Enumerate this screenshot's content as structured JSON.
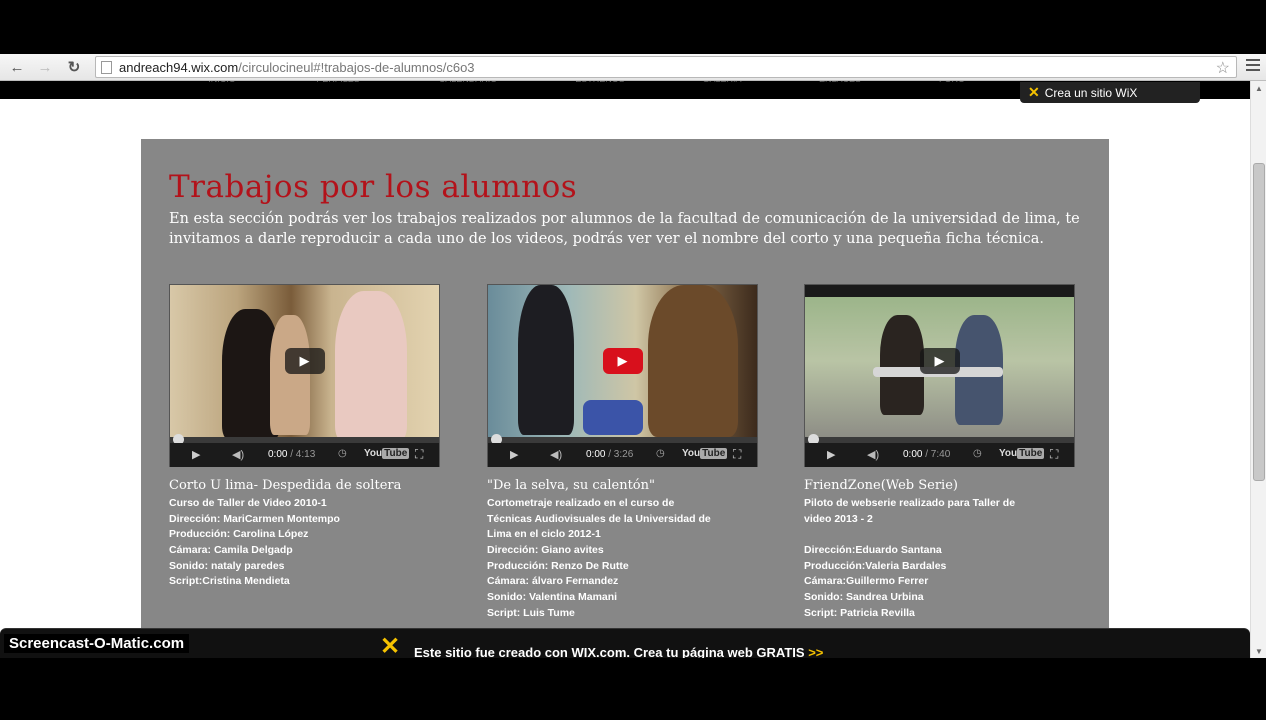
{
  "browser": {
    "url_host": "andreach94.wix.com",
    "url_path": "/circulocineul#!trabajos-de-alumnos/c6o3"
  },
  "site_nav": [
    "INICIO",
    "PERFILES",
    "CALENDARIO",
    "ESTRENOS",
    "GALERIA",
    "ENLACES",
    "FORO"
  ],
  "wix_badge": "Crea un sitio WiX",
  "section": {
    "title": "Trabajos por los alumnos",
    "intro": "En esta sección podrás ver los trabajos realizados por alumnos de la facultad de comunicación de la universidad de lima, te invitamos a darle reproducir a cada uno de los videos, podrás ver ver el nombre del corto y una pequeña ficha técnica."
  },
  "videos": [
    {
      "time": "0:00",
      "duration": "/ 4:13",
      "title": "Corto U lima- Despedida de soltera",
      "lines": [
        "Curso de Taller de Video 2010-1",
        "Dirección: MariCarmen Montempo",
        "Producción: Carolina López",
        "Cámara: Camila Delgadp",
        "Sonido: nataly paredes",
        "Script:Cristina Mendieta"
      ]
    },
    {
      "time": "0:00",
      "duration": "/ 3:26",
      "title": "\"De la selva, su calentón\"",
      "lines": [
        "Cortometraje realizado en el curso de",
        "Técnicas Audiovisuales de la Universidad de",
        "Lima en el ciclo 2012-1",
        "Dirección: Giano avites",
        "Producción: Renzo De Rutte",
        "Cámara: álvaro Fernandez",
        "Sonido: Valentina Mamani",
        "Script: Luis Tume"
      ]
    },
    {
      "time": "0:00",
      "duration": "/ 7:40",
      "title": "FriendZone(Web Serie)",
      "lines": [
        "Piloto de webserie realizado para Taller de",
        "video 2013 - 2",
        "",
        "Dirección:Eduardo Santana",
        "Producción:Valeria Bardales",
        "Cámara:Guillermo Ferrer",
        "Sonido: Sandrea Urbina",
        "Script: Patricia Revilla"
      ]
    }
  ],
  "player": {
    "youtube_label": "You",
    "youtube_tube": "Tube"
  },
  "wix_banner": {
    "message": "Este sitio fue creado con WIX.com. Crea tu página web GRATIS",
    "arrows": ">>"
  },
  "watermark": "Screencast-O-Matic.com"
}
